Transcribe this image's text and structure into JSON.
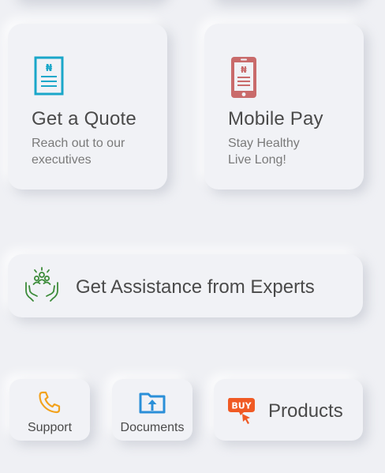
{
  "tiles": {
    "quote": {
      "title": "Get a Quote",
      "subtitle_line1": "Reach out to our",
      "subtitle_line2": "executives",
      "icon": "naira-document-icon",
      "icon_symbol": "₦",
      "icon_color": "#1aa7c9"
    },
    "mobile_pay": {
      "title": "Mobile Pay",
      "subtitle_line1": "Stay Healthy",
      "subtitle_line2": "Live Long!",
      "icon": "naira-phone-icon",
      "icon_symbol": "₦",
      "icon_color": "#c96b6b"
    }
  },
  "assistance": {
    "label": "Get Assistance from Experts",
    "icon": "expert-hands-icon",
    "icon_color": "#3c8b3a"
  },
  "shortcuts": [
    {
      "label": "Support",
      "icon": "phone-icon",
      "icon_color": "#f2a21d"
    },
    {
      "label": "Documents",
      "icon": "folder-upload-icon",
      "icon_color": "#2a8fd8"
    }
  ],
  "products": {
    "label": "Products",
    "icon": "buy-tag-icon",
    "badge_text": "BUY",
    "icon_color": "#f05a24"
  }
}
